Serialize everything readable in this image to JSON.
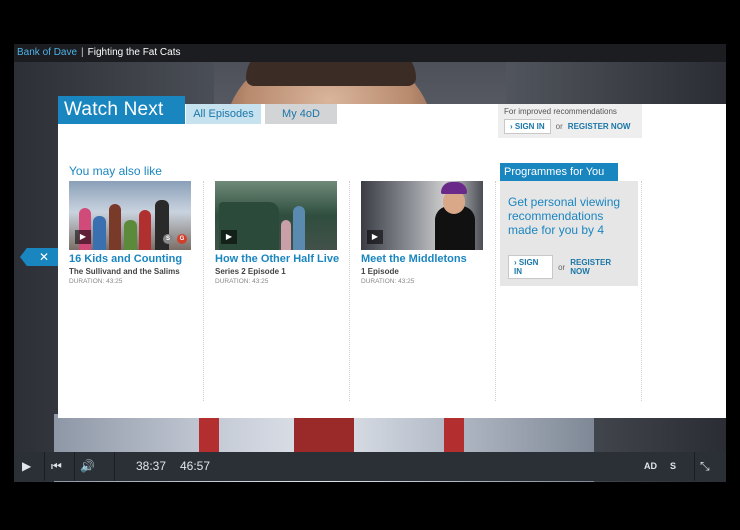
{
  "titlebar": {
    "show": "Bank of Dave",
    "separator": "|",
    "episode": "Fighting the Fat Cats"
  },
  "tabs": {
    "watch_next": "Watch Next",
    "all_episodes": "All Episodes",
    "my_4od": "My 4oD"
  },
  "signin_top": {
    "hint": "For improved recommendations",
    "sign_in": "› SIGN IN",
    "or": "or",
    "register": "REGISTER NOW"
  },
  "also": {
    "title": "You may also like"
  },
  "cards": [
    {
      "title": "16 Kids and Counting",
      "subtitle": "The Sullivand and the Salims",
      "duration": "DURATION: 43:25",
      "play": "▶",
      "badges": [
        "S",
        "G"
      ]
    },
    {
      "title": "How the Other Half Live",
      "subtitle": "Series 2 Episode 1",
      "duration": "DURATION: 43:25",
      "play": "▶"
    },
    {
      "title": "Meet the Middletons",
      "subtitle": "1 Episode",
      "duration": "DURATION: 43:25",
      "play": "▶"
    }
  ],
  "programmes_for_you": {
    "heading": "Programmes for You",
    "message": "Get personal viewing recommendations made for you by 4",
    "sign_in": "› SIGN IN",
    "or": "or",
    "register": "REGISTER NOW"
  },
  "close_tab": "✕",
  "controls": {
    "play": "▶",
    "prev": "⏮",
    "volume": "🔊",
    "time_current": "38:37",
    "time_total": "46:57",
    "ad": "AD",
    "subtitles": "S",
    "fullscreen": "⤡"
  },
  "colors": {
    "accent": "#1a86c0",
    "control_bar": "#2b3036",
    "panel": "#ffffff"
  }
}
